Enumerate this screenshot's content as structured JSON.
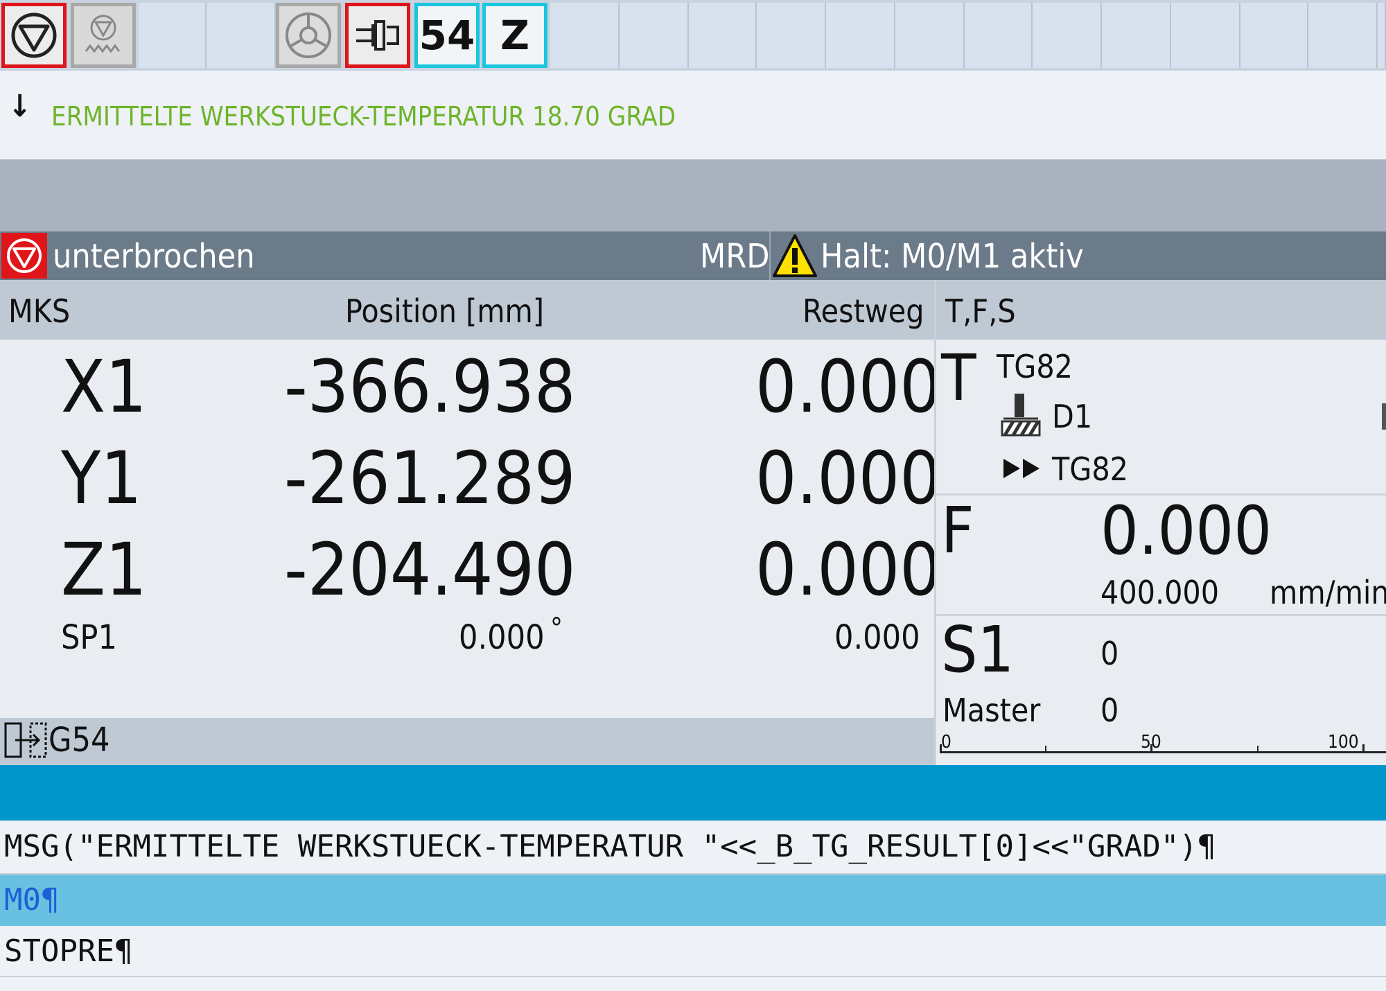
{
  "topbar": {
    "icon_54": "54",
    "icon_z": "Z",
    "colors": {
      "red": "#e0151a",
      "cyan": "#19c6de"
    }
  },
  "message": {
    "text": "ERMITTELTE WERKSTUECK-TEMPERATUR 18.70 GRAD",
    "color": "#6db42b"
  },
  "status": {
    "state": "unterbrochen",
    "mode": "MRD",
    "alarm": "Halt: M0/M1 aktiv"
  },
  "position": {
    "header_coord": "MKS",
    "header_position": "Position [mm]",
    "header_rest": "Restweg",
    "axes": [
      {
        "name": "X1",
        "position": "-366.938",
        "rest": "0.000"
      },
      {
        "name": "Y1",
        "position": "-261.289",
        "rest": "0.000"
      },
      {
        "name": "Z1",
        "position": "-204.490",
        "rest": "0.000"
      }
    ],
    "spindle": {
      "name": "SP1",
      "position": "0.000",
      "unit": "°",
      "rest": "0.000"
    },
    "work_offset": "G54"
  },
  "tfs": {
    "header": "T,F,S",
    "tool_label": "T",
    "tool_name": "TG82",
    "cutting_edge": "D1",
    "next_tool": "TG82",
    "feed_label": "F",
    "feed_actual": "0.000",
    "feed_set": "400.000",
    "feed_unit": "mm/min",
    "spindle_label": "S1",
    "spindle_value": "0",
    "master_label": "Master",
    "master_value": "0",
    "scale": [
      "0",
      "50",
      "100"
    ]
  },
  "program": {
    "line1": "MSG(\"ERMITTELTE WERKSTUECK-TEMPERATUR \"<<_B_TG_RESULT[0]<<\"GRAD\")¶",
    "line2": "M0¶",
    "line3": "STOPRE¶"
  }
}
